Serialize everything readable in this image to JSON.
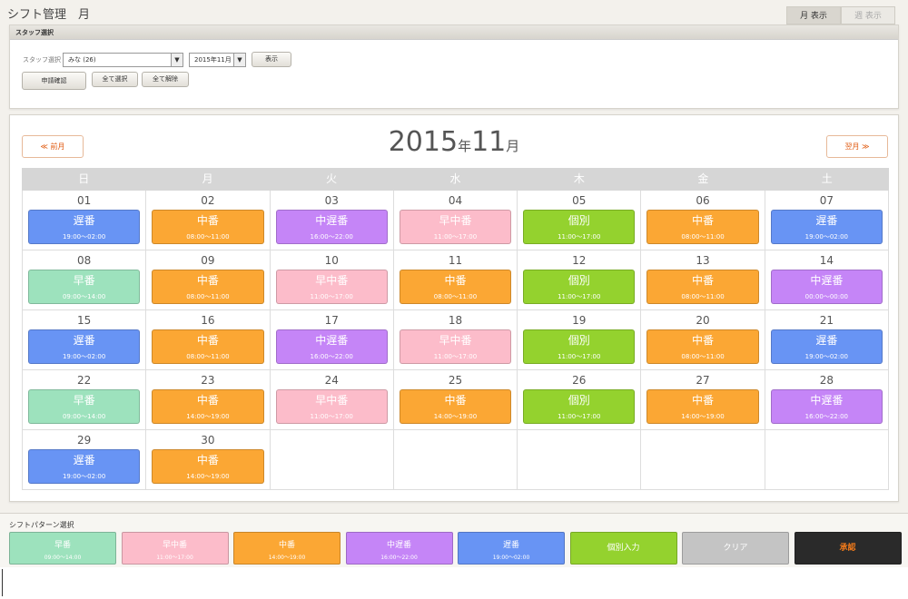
{
  "header": {
    "title": "シフト管理　月",
    "tabs": [
      {
        "label": "月 表示",
        "active": true
      },
      {
        "label": "週 表示",
        "active": false
      }
    ]
  },
  "staff_panel": {
    "title": "スタッフ選択",
    "staff_label": "スタッフ選択",
    "staff_select": "みな (26)",
    "month_select": "2015年11月",
    "show_button": "表示",
    "apply_button": "申請確認",
    "select_all_button": "全て選択",
    "clear_all_button": "全て解除"
  },
  "calendar": {
    "prev_label": "≪ 前月",
    "next_label": "翌月 ≫",
    "year": "2015",
    "year_unit": "年",
    "month": "11",
    "month_unit": "月",
    "weekdays": [
      "日",
      "月",
      "火",
      "水",
      "木",
      "金",
      "土"
    ],
    "weeks": [
      [
        {
          "day": "01",
          "shift": "遅番",
          "time": "19:00〜02:00",
          "color": "#6894f4"
        },
        {
          "day": "02",
          "shift": "中番",
          "time": "08:00〜11:00",
          "color": "#fba734"
        },
        {
          "day": "03",
          "shift": "中遅番",
          "time": "16:00〜22:00",
          "color": "#c585f7"
        },
        {
          "day": "04",
          "shift": "早中番",
          "time": "11:00〜17:00",
          "color": "#fcbcca"
        },
        {
          "day": "05",
          "shift": "個別",
          "time": "11:00〜17:00",
          "color": "#94d22e"
        },
        {
          "day": "06",
          "shift": "中番",
          "time": "08:00〜11:00",
          "color": "#fba734"
        },
        {
          "day": "07",
          "shift": "遅番",
          "time": "19:00〜02:00",
          "color": "#6894f4"
        }
      ],
      [
        {
          "day": "08",
          "shift": "早番",
          "time": "09:00〜14:00",
          "color": "#9de2bd"
        },
        {
          "day": "09",
          "shift": "中番",
          "time": "08:00〜11:00",
          "color": "#fba734"
        },
        {
          "day": "10",
          "shift": "早中番",
          "time": "11:00〜17:00",
          "color": "#fcbcca"
        },
        {
          "day": "11",
          "shift": "中番",
          "time": "08:00〜11:00",
          "color": "#fba734"
        },
        {
          "day": "12",
          "shift": "個別",
          "time": "11:00〜17:00",
          "color": "#94d22e"
        },
        {
          "day": "13",
          "shift": "中番",
          "time": "08:00〜11:00",
          "color": "#fba734"
        },
        {
          "day": "14",
          "shift": "中遅番",
          "time": "00:00〜00:00",
          "color": "#c585f7"
        }
      ],
      [
        {
          "day": "15",
          "shift": "遅番",
          "time": "19:00〜02:00",
          "color": "#6894f4"
        },
        {
          "day": "16",
          "shift": "中番",
          "time": "08:00〜11:00",
          "color": "#fba734"
        },
        {
          "day": "17",
          "shift": "中遅番",
          "time": "16:00〜22:00",
          "color": "#c585f7"
        },
        {
          "day": "18",
          "shift": "早中番",
          "time": "11:00〜17:00",
          "color": "#fcbcca"
        },
        {
          "day": "19",
          "shift": "個別",
          "time": "11:00〜17:00",
          "color": "#94d22e"
        },
        {
          "day": "20",
          "shift": "中番",
          "time": "08:00〜11:00",
          "color": "#fba734"
        },
        {
          "day": "21",
          "shift": "遅番",
          "time": "19:00〜02:00",
          "color": "#6894f4"
        }
      ],
      [
        {
          "day": "22",
          "shift": "早番",
          "time": "09:00〜14:00",
          "color": "#9de2bd"
        },
        {
          "day": "23",
          "shift": "中番",
          "time": "14:00〜19:00",
          "color": "#fba734"
        },
        {
          "day": "24",
          "shift": "早中番",
          "time": "11:00〜17:00",
          "color": "#fcbcca"
        },
        {
          "day": "25",
          "shift": "中番",
          "time": "14:00〜19:00",
          "color": "#fba734"
        },
        {
          "day": "26",
          "shift": "個別",
          "time": "11:00〜17:00",
          "color": "#94d22e"
        },
        {
          "day": "27",
          "shift": "中番",
          "time": "14:00〜19:00",
          "color": "#fba734"
        },
        {
          "day": "28",
          "shift": "中遅番",
          "time": "16:00〜22:00",
          "color": "#c585f7"
        }
      ],
      [
        {
          "day": "29",
          "shift": "遅番",
          "time": "19:00〜02:00",
          "color": "#6894f4"
        },
        {
          "day": "30",
          "shift": "中番",
          "time": "14:00〜19:00",
          "color": "#fba734"
        },
        null,
        null,
        null,
        null,
        null
      ]
    ]
  },
  "patterns": {
    "title": "シフトパターン選択",
    "items": [
      {
        "name": "早番",
        "time": "09:00〜14:00",
        "color": "#9de2bd",
        "text_color": "#ffffff"
      },
      {
        "name": "早中番",
        "time": "11:00〜17:00",
        "color": "#fcbcca",
        "text_color": "#ffffff"
      },
      {
        "name": "中番",
        "time": "14:00〜19:00",
        "color": "#fba734",
        "text_color": "#ffffff"
      },
      {
        "name": "中遅番",
        "time": "16:00〜22:00",
        "color": "#c585f7",
        "text_color": "#ffffff"
      },
      {
        "name": "遅番",
        "time": "19:00〜02:00",
        "color": "#6894f4",
        "text_color": "#ffffff"
      },
      {
        "name": "個別入力",
        "time": "",
        "color": "#94d22e",
        "text_color": "#ffffff"
      },
      {
        "name": "クリア",
        "time": "",
        "color": "#c4c4c4",
        "text_color": "#ffffff"
      },
      {
        "name": "承認",
        "time": "",
        "color": "#2a2a2a",
        "text_color": "#f07a1a"
      }
    ]
  }
}
